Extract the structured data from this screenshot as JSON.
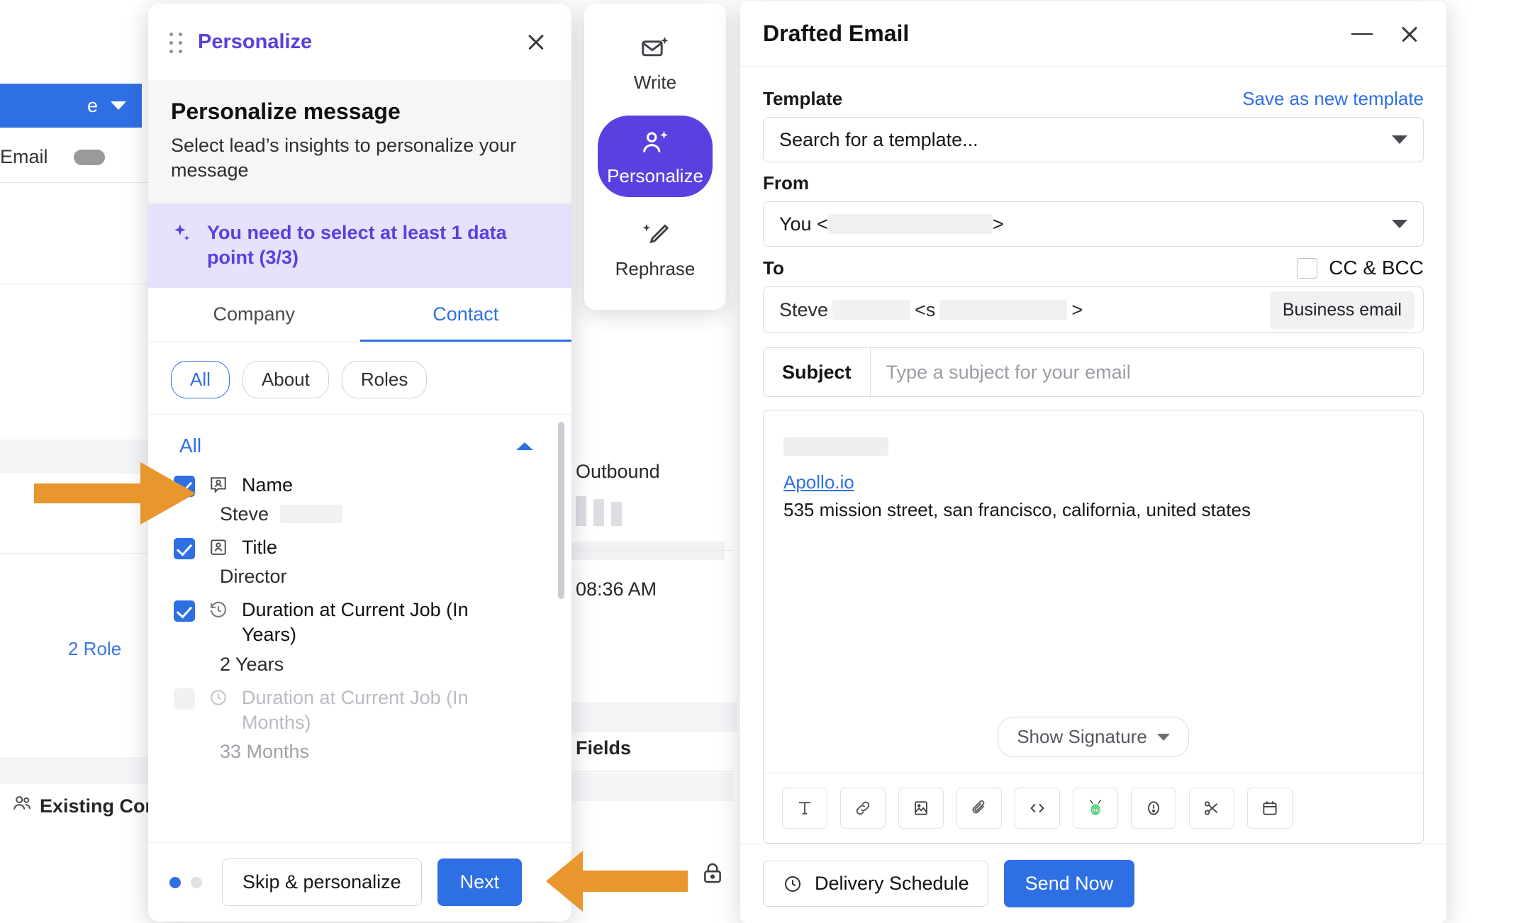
{
  "background": {
    "toolbar_label": "e",
    "email_col_label": "Email",
    "roles_link": "2 Role",
    "existing_contacts_label": "Existing Cor",
    "outbound_label": "Outbound",
    "time_label": "08:36 AM",
    "fields_label": "Fields"
  },
  "personalize": {
    "window_title": "Personalize",
    "heading": "Personalize message",
    "subheading": "Select lead’s insights to personalize your message",
    "alert": "You need to select at least 1 data point (3/3)",
    "tabs": [
      {
        "label": "Company",
        "active": false
      },
      {
        "label": "Contact",
        "active": true
      }
    ],
    "chips": [
      {
        "label": "All",
        "active": true
      },
      {
        "label": "About",
        "active": false
      },
      {
        "label": "Roles",
        "active": false
      }
    ],
    "group_label": "All",
    "options": [
      {
        "label": "Name",
        "value": "Steve",
        "value_redacted": true,
        "icon": "contact-card-icon",
        "checked": true,
        "disabled": false
      },
      {
        "label": "Title",
        "value": "Director",
        "value_redacted": false,
        "icon": "contact-card-icon",
        "checked": true,
        "disabled": false
      },
      {
        "label": "Duration at Current Job (In Years)",
        "value": "2 Years",
        "value_redacted": false,
        "icon": "history-clock-icon",
        "checked": true,
        "disabled": false
      },
      {
        "label": "Duration at Current Job (In Months)",
        "value": "33 Months",
        "value_redacted": false,
        "icon": "clock-icon",
        "checked": false,
        "disabled": true
      }
    ],
    "footer": {
      "skip_label": "Skip & personalize",
      "next_label": "Next",
      "step_current": 1,
      "step_total": 2
    }
  },
  "ai_rail": {
    "items": [
      {
        "label": "Write",
        "icon": "mail-sparkle-icon",
        "active": false
      },
      {
        "label": "Personalize",
        "icon": "person-sparkle-icon",
        "active": true
      },
      {
        "label": "Rephrase",
        "icon": "pencil-sparkle-icon",
        "active": false
      }
    ],
    "active_color": "#5b3fe0"
  },
  "email": {
    "title": "Drafted Email",
    "template_label": "Template",
    "save_template_link": "Save as new template",
    "template_placeholder": "Search for a template...",
    "from_label": "From",
    "from_value": "You <",
    "from_value_tail": ">",
    "to_label": "To",
    "cc_bcc_label": "CC & BCC",
    "to_value": "Steve",
    "to_value_mid": "<s",
    "to_value_tail": ">",
    "business_email_badge": "Business email",
    "subject_label": "Subject",
    "subject_placeholder": "Type a subject for your email",
    "subject_value": "",
    "signature_link": "Apollo.io",
    "signature_address": "535 mission street, san francisco, california, united states",
    "show_signature_label": "Show Signature",
    "toolbar_icons": [
      "text-format-icon",
      "link-icon",
      "image-icon",
      "attachment-icon",
      "code-icon",
      "apollo-alien-icon",
      "exclamation-circle-icon",
      "scissors-icon",
      "calendar-icon"
    ],
    "delivery_schedule_label": "Delivery Schedule",
    "send_now_label": "Send Now",
    "accent_color": "#2f6fe4"
  }
}
